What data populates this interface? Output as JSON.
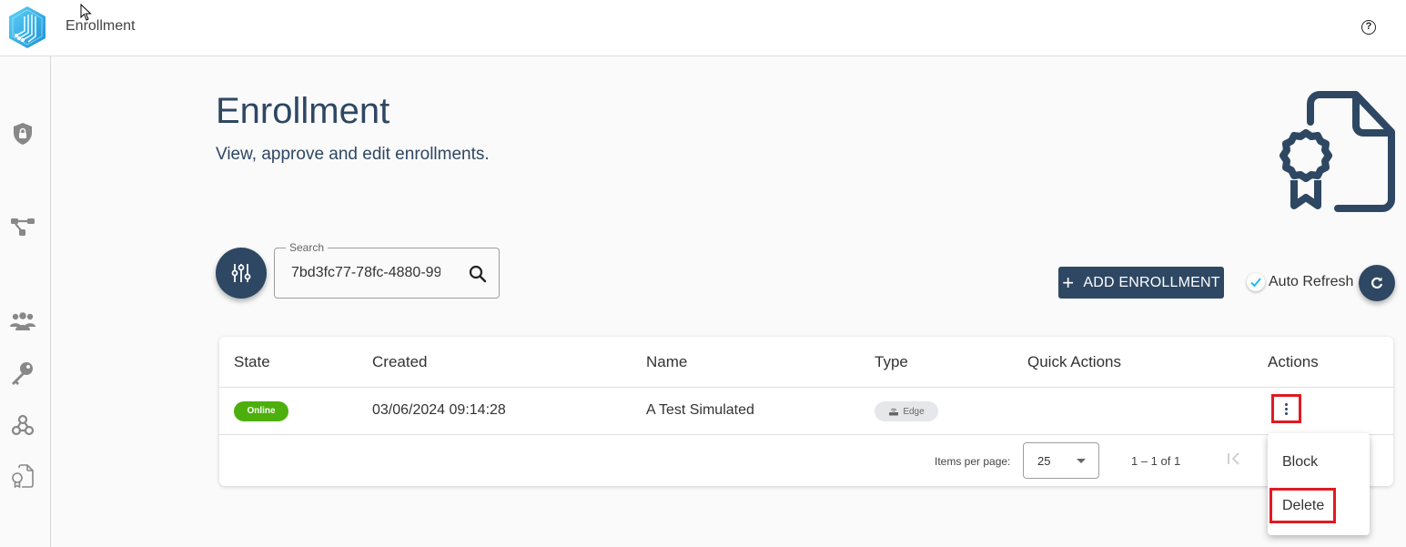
{
  "app": {
    "title": "Enrollment",
    "help_icon": "help-circle-icon",
    "logo": "hexagon-circuit-logo"
  },
  "sidebar": {
    "items": [
      {
        "name": "security",
        "icon": "shield-lock-icon"
      },
      {
        "name": "topology",
        "icon": "network-nodes-icon"
      },
      {
        "name": "users",
        "icon": "users-group-icon"
      },
      {
        "name": "keys",
        "icon": "key-icon"
      },
      {
        "name": "webhooks",
        "icon": "webhook-icon"
      },
      {
        "name": "enrollment",
        "icon": "certificate-document-icon"
      }
    ]
  },
  "page": {
    "title": "Enrollment",
    "subtitle": "View, approve and edit enrollments.",
    "hero_icon": "certificate-document-icon"
  },
  "toolbar": {
    "filter_icon": "sliders-icon",
    "search_label": "Search",
    "search_value": "7bd3fc77-78fc-4880-99",
    "add_label": "ADD ENROLLMENT",
    "add_icon": "+",
    "auto_refresh_label": "Auto Refresh",
    "auto_refresh_checked": true,
    "refresh_icon": "refresh-icon"
  },
  "table": {
    "columns": [
      "State",
      "Created",
      "Name",
      "Type",
      "Quick Actions",
      "Actions"
    ],
    "rows": [
      {
        "state": "Online",
        "created": "03/06/2024 09:14:28",
        "name": "A Test Simulated",
        "type": "Edge",
        "quick_actions": ""
      }
    ],
    "paginator": {
      "items_per_page_label": "Items per page:",
      "items_per_page": "25",
      "range": "1 – 1 of 1"
    }
  },
  "actions_menu": {
    "items": [
      "Block",
      "Delete"
    ]
  },
  "colors": {
    "primary": "#2e4763",
    "online": "#4caf0c",
    "highlight": "#e01a22",
    "accent_check": "#29b6f6"
  }
}
